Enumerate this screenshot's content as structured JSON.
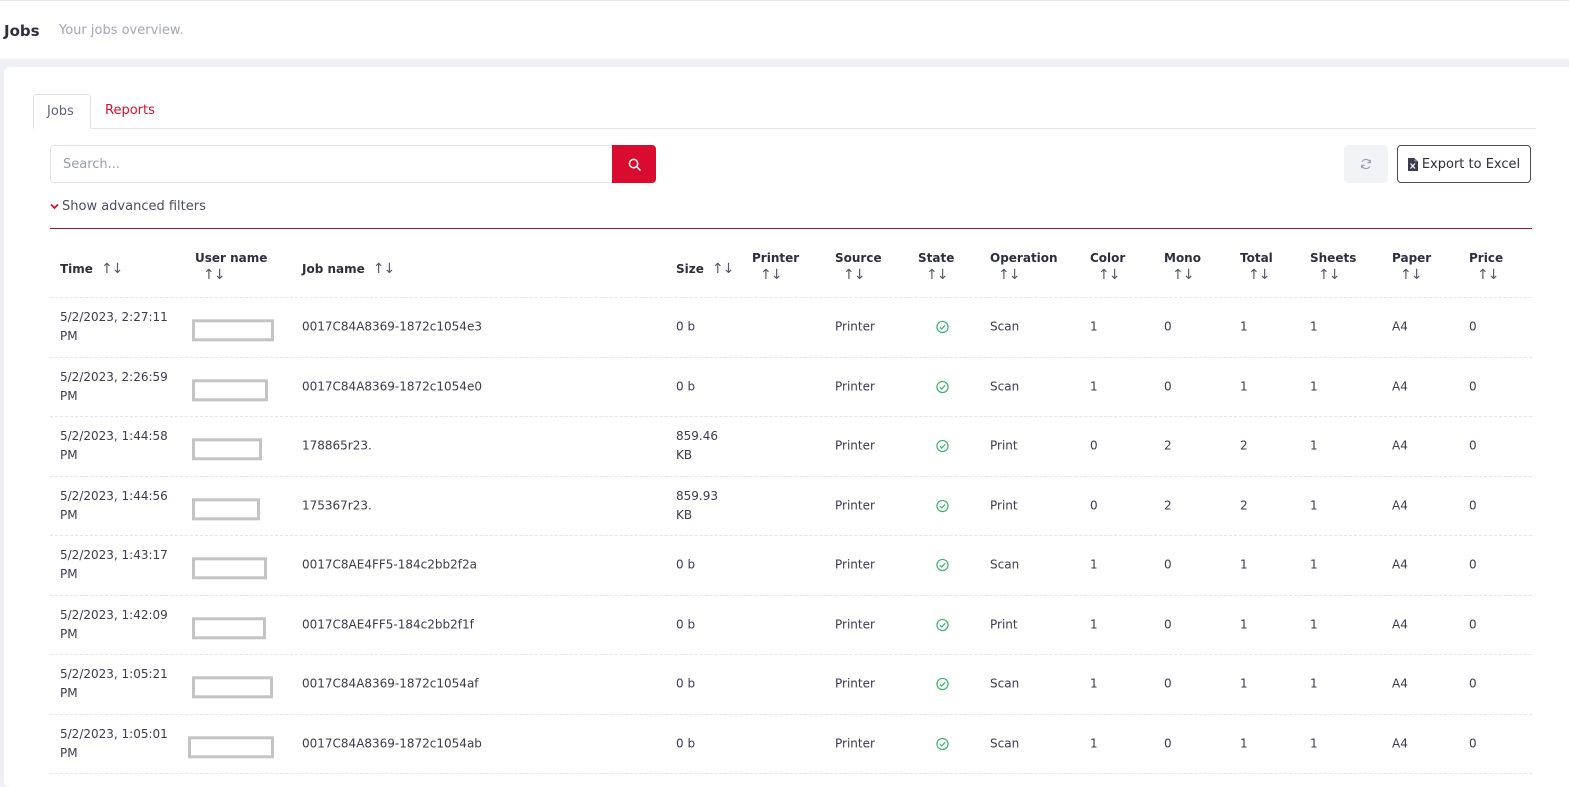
{
  "header": {
    "title": "Jobs",
    "subtitle": "Your jobs overview."
  },
  "tabs": [
    {
      "label": "Jobs",
      "active": true
    },
    {
      "label": "Reports",
      "active": false
    }
  ],
  "search": {
    "placeholder": "Search...",
    "value": ""
  },
  "toolbar": {
    "export_label": "Export to Excel"
  },
  "filters": {
    "toggle_label": "Show advanced filters"
  },
  "table": {
    "columns": [
      "Time",
      "User name",
      "Job name",
      "Size",
      "Printer",
      "Source",
      "State",
      "Operation",
      "Color",
      "Mono",
      "Total",
      "Sheets",
      "Paper",
      "Price"
    ],
    "rows": [
      {
        "time1": "5/2/2023, 2:27:11",
        "time2": "PM",
        "job": "0017C84A8369-1872c1054e3",
        "size1": "0 b",
        "size2": "",
        "source": "Printer",
        "operation": "Scan",
        "color": "1",
        "mono": "0",
        "total": "1",
        "sheets": "1",
        "paper": "A4",
        "price": "0"
      },
      {
        "time1": "5/2/2023, 2:26:59",
        "time2": "PM",
        "job": "0017C84A8369-1872c1054e0",
        "size1": "0 b",
        "size2": "",
        "source": "Printer",
        "operation": "Scan",
        "color": "1",
        "mono": "0",
        "total": "1",
        "sheets": "1",
        "paper": "A4",
        "price": "0"
      },
      {
        "time1": "5/2/2023, 1:44:58",
        "time2": "PM",
        "job": "178865r23.",
        "size1": "859.46",
        "size2": "KB",
        "source": "Printer",
        "operation": "Print",
        "color": "0",
        "mono": "2",
        "total": "2",
        "sheets": "1",
        "paper": "A4",
        "price": "0"
      },
      {
        "time1": "5/2/2023, 1:44:56",
        "time2": "PM",
        "job": "175367r23.",
        "size1": "859.93",
        "size2": "KB",
        "source": "Printer",
        "operation": "Print",
        "color": "0",
        "mono": "2",
        "total": "2",
        "sheets": "1",
        "paper": "A4",
        "price": "0"
      },
      {
        "time1": "5/2/2023, 1:43:17",
        "time2": "PM",
        "job": "0017C8AE4FF5-184c2bb2f2a",
        "size1": "0 b",
        "size2": "",
        "source": "Printer",
        "operation": "Scan",
        "color": "1",
        "mono": "0",
        "total": "1",
        "sheets": "1",
        "paper": "A4",
        "price": "0"
      },
      {
        "time1": "5/2/2023, 1:42:09",
        "time2": "PM",
        "job": "0017C8AE4FF5-184c2bb2f1f",
        "size1": "0 b",
        "size2": "",
        "source": "Printer",
        "operation": "Print",
        "color": "1",
        "mono": "0",
        "total": "1",
        "sheets": "1",
        "paper": "A4",
        "price": "0"
      },
      {
        "time1": "5/2/2023, 1:05:21",
        "time2": "PM",
        "job": "0017C84A8369-1872c1054af",
        "size1": "0 b",
        "size2": "",
        "source": "Printer",
        "operation": "Scan",
        "color": "1",
        "mono": "0",
        "total": "1",
        "sheets": "1",
        "paper": "A4",
        "price": "0"
      },
      {
        "time1": "5/2/2023, 1:05:01",
        "time2": "PM",
        "job": "0017C84A8369-1872c1054ab",
        "size1": "0 b",
        "size2": "",
        "source": "Printer",
        "operation": "Scan",
        "color": "1",
        "mono": "0",
        "total": "1",
        "sheets": "1",
        "paper": "A4",
        "price": "0"
      }
    ]
  },
  "icons": {
    "search": "search-icon",
    "refresh": "refresh-icon",
    "export": "excel-file-icon",
    "filters": "chevron-down-icon",
    "sort": "sort-icon",
    "state": "check-circle-icon"
  },
  "colors": {
    "accent": "#d90b2f",
    "success": "#3cb371",
    "divider": "#8c1a44"
  }
}
